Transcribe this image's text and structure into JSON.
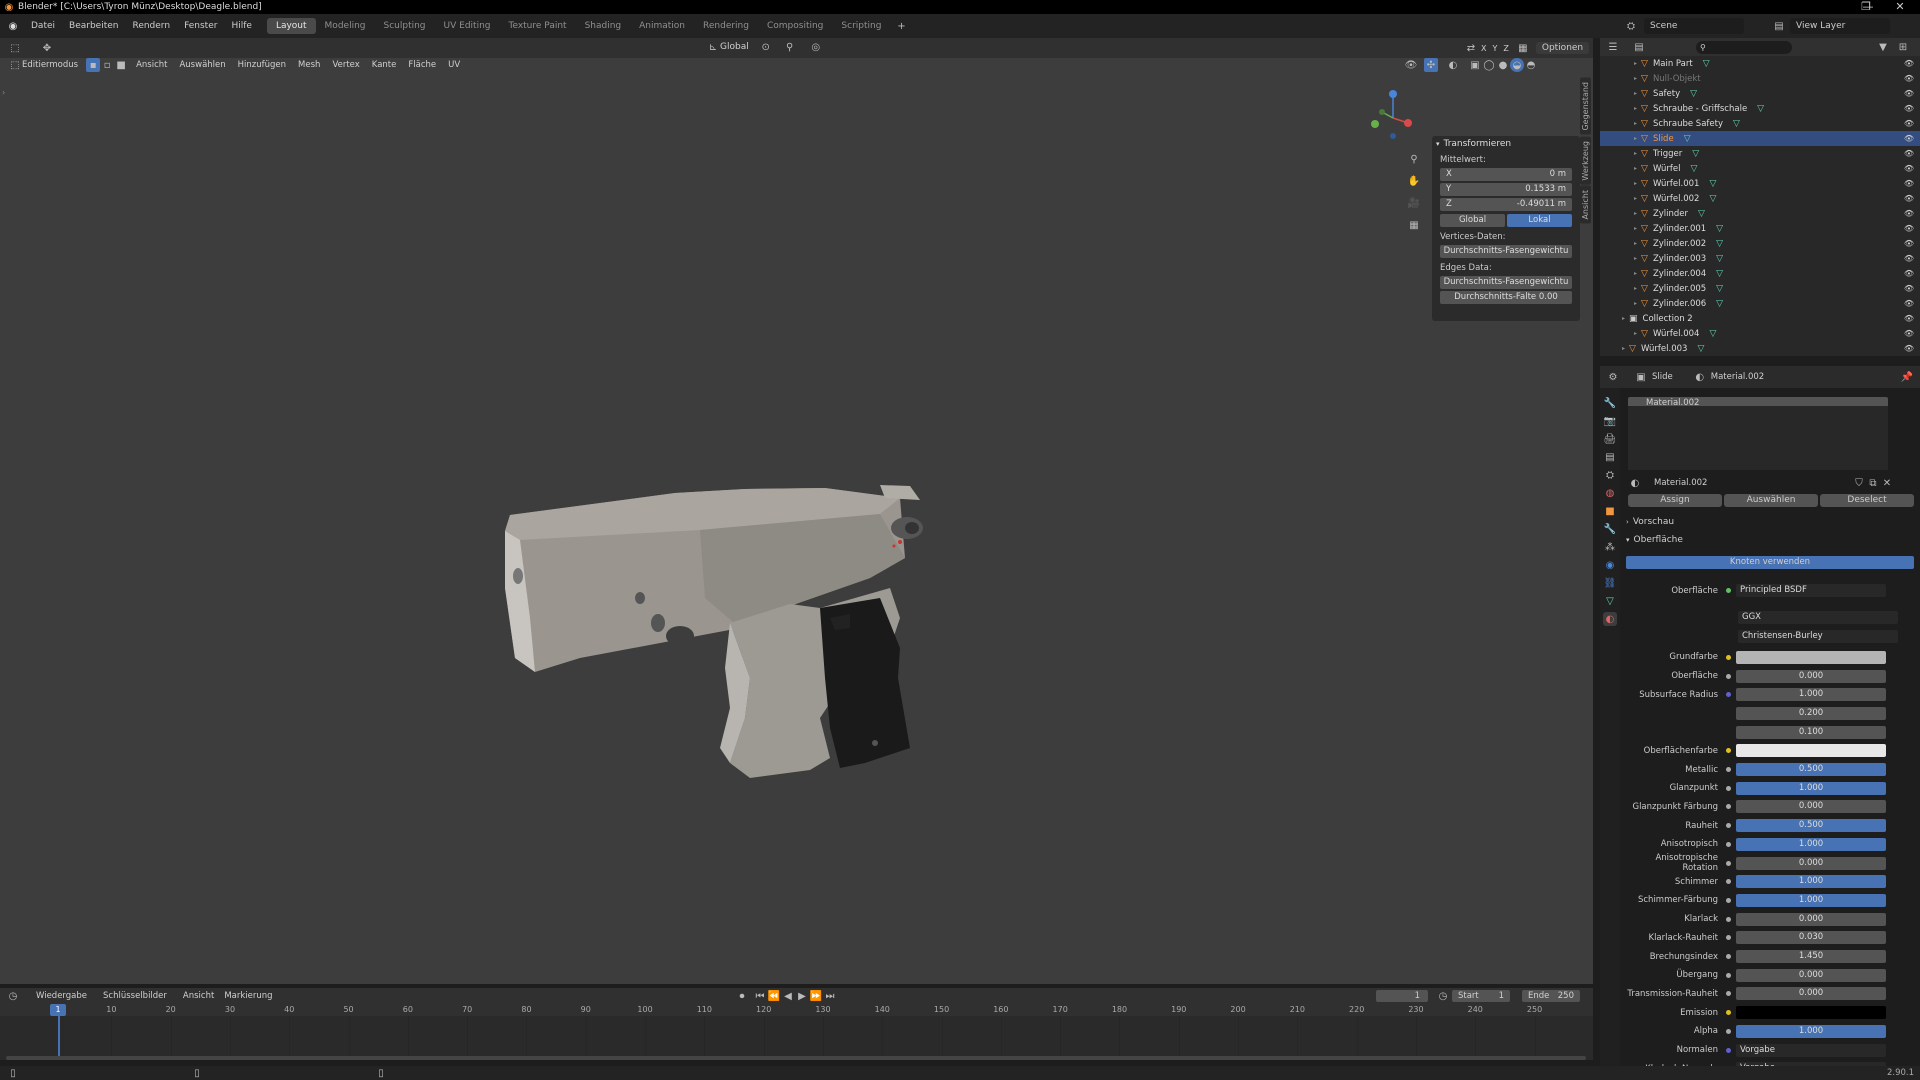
{
  "title": "Blender* [C:\\Users\\Tyron Münz\\Desktop\\Deagle.blend]",
  "menu": [
    "Datei",
    "Bearbeiten",
    "Rendern",
    "Fenster",
    "Hilfe"
  ],
  "workspaces": [
    "Layout",
    "Modeling",
    "Sculpting",
    "UV Editing",
    "Texture Paint",
    "Shading",
    "Animation",
    "Rendering",
    "Compositing",
    "Scripting"
  ],
  "scene": "Scene",
  "view_layer": "View Layer",
  "header3d": {
    "orientation": "Global",
    "options": "Optionen",
    "axes": [
      "X",
      "Y",
      "Z"
    ]
  },
  "header3d2": {
    "mode": "Editiermodus",
    "items": [
      "Ansicht",
      "Auswählen",
      "Hinzufügen",
      "Mesh",
      "Vertex",
      "Kante",
      "Fläche",
      "UV"
    ]
  },
  "npanel": {
    "title": "Transformieren",
    "median": "Mittelwert:",
    "x_label": "X",
    "x": "0 m",
    "y_label": "Y",
    "y": "0.1533 m",
    "z_label": "Z",
    "z": "-0.49011 m",
    "global": "Global",
    "lokal": "Lokal",
    "vertices": "Vertices-Daten:",
    "vbtn": "Durchschnitts-Fasengewichtu",
    "edges": "Edges Data:",
    "ebtn1": "Durchschnitts-Fasengewichtu",
    "ebtn2": "Durchschnitts-Falte 0.00"
  },
  "sidetabs": [
    "Gegenstand",
    "Werkzeug",
    "Ansicht"
  ],
  "outliner": [
    {
      "name": "Main Part",
      "sel": false,
      "dim": false
    },
    {
      "name": "Null-Objekt",
      "sel": false,
      "dim": true
    },
    {
      "name": "Safety",
      "sel": false,
      "dim": false
    },
    {
      "name": "Schraube - Griffschale",
      "sel": false,
      "dim": false
    },
    {
      "name": "Schraube Safety",
      "sel": false,
      "dim": false
    },
    {
      "name": "Slide",
      "sel": true,
      "dim": false
    },
    {
      "name": "Trigger",
      "sel": false,
      "dim": false
    },
    {
      "name": "Würfel",
      "sel": false,
      "dim": false
    },
    {
      "name": "Würfel.001",
      "sel": false,
      "dim": false
    },
    {
      "name": "Würfel.002",
      "sel": false,
      "dim": false
    },
    {
      "name": "Zylinder",
      "sel": false,
      "dim": false
    },
    {
      "name": "Zylinder.001",
      "sel": false,
      "dim": false
    },
    {
      "name": "Zylinder.002",
      "sel": false,
      "dim": false
    },
    {
      "name": "Zylinder.003",
      "sel": false,
      "dim": false
    },
    {
      "name": "Zylinder.004",
      "sel": false,
      "dim": false
    },
    {
      "name": "Zylinder.005",
      "sel": false,
      "dim": false
    },
    {
      "name": "Zylinder.006",
      "sel": false,
      "dim": false
    },
    {
      "name": "Collection 2",
      "sel": false,
      "dim": false
    },
    {
      "name": "Würfel.004",
      "sel": false,
      "dim": false
    },
    {
      "name": "Würfel.003",
      "sel": false,
      "dim": false
    }
  ],
  "props": {
    "object": "Slide",
    "material": "Material.002",
    "slot": "Material.002",
    "matfield": "Material.002",
    "assign": "Assign",
    "select": "Auswählen",
    "deselect": "Deselect",
    "preview": "Vorschau",
    "surface": "Oberfläche",
    "use_nodes": "Knoten verwenden",
    "surf_label": "Oberfläche",
    "surf_val": "Principled BSDF",
    "dist": "GGX",
    "sss": "Christensen-Burley"
  },
  "params": [
    {
      "label": "Grundfarbe",
      "value": "",
      "kind": "color",
      "color": "#b4b4b4",
      "dot": "#e0c020"
    },
    {
      "label": "Oberfläche",
      "value": "0.000",
      "kind": "num",
      "dot": "#aaa"
    },
    {
      "label": "Subsurface Radius",
      "value": "1.000",
      "kind": "num",
      "dot": "#6060d0"
    },
    {
      "label": "",
      "value": "0.200",
      "kind": "num",
      "dot": ""
    },
    {
      "label": "",
      "value": "0.100",
      "kind": "num",
      "dot": ""
    },
    {
      "label": "Oberflächenfarbe",
      "value": "",
      "kind": "color",
      "color": "#e8e8e8",
      "dot": "#e0c020"
    },
    {
      "label": "Metallic",
      "value": "0.500",
      "kind": "blue",
      "dot": "#aaa"
    },
    {
      "label": "Glanzpunkt",
      "value": "1.000",
      "kind": "blue",
      "dot": "#aaa"
    },
    {
      "label": "Glanzpunkt Färbung",
      "value": "0.000",
      "kind": "num",
      "dot": "#aaa"
    },
    {
      "label": "Rauheit",
      "value": "0.500",
      "kind": "blue",
      "dot": "#aaa"
    },
    {
      "label": "Anisotropisch",
      "value": "1.000",
      "kind": "blue",
      "dot": "#aaa"
    },
    {
      "label": "Anisotropische Rotation",
      "value": "0.000",
      "kind": "num",
      "dot": "#aaa"
    },
    {
      "label": "Schimmer",
      "value": "1.000",
      "kind": "blue",
      "dot": "#aaa"
    },
    {
      "label": "Schimmer-Färbung",
      "value": "1.000",
      "kind": "blue",
      "dot": "#aaa"
    },
    {
      "label": "Klarlack",
      "value": "0.000",
      "kind": "num",
      "dot": "#aaa"
    },
    {
      "label": "Klarlack-Rauheit",
      "value": "0.030",
      "kind": "num",
      "dot": "#aaa"
    },
    {
      "label": "Brechungsindex",
      "value": "1.450",
      "kind": "num",
      "dot": "#aaa"
    },
    {
      "label": "Übergang",
      "value": "0.000",
      "kind": "num",
      "dot": "#aaa"
    },
    {
      "label": "Transmission-Rauheit",
      "value": "0.000",
      "kind": "num",
      "dot": "#aaa"
    },
    {
      "label": "Emission",
      "value": "",
      "kind": "color",
      "color": "#000000",
      "dot": "#e0c020"
    },
    {
      "label": "Alpha",
      "value": "1.000",
      "kind": "blue",
      "dot": "#aaa"
    },
    {
      "label": "Normalen",
      "value": "Vorgabe",
      "kind": "text",
      "dot": "#6060d0"
    },
    {
      "label": "Klarlack-Normale",
      "value": "Vorgabe",
      "kind": "text",
      "dot": "#6060d0"
    }
  ],
  "timeline": {
    "playback": "Wiedergabe",
    "keys": "Schlüsselbilder",
    "view": "Ansicht",
    "markers": "Markierung",
    "current": "1",
    "start_label": "Start",
    "start": "1",
    "end_label": "Ende",
    "end": "250",
    "ticks": [
      "1",
      "10",
      "20",
      "30",
      "40",
      "50",
      "60",
      "70",
      "80",
      "90",
      "100",
      "110",
      "120",
      "130",
      "140",
      "150",
      "160",
      "170",
      "180",
      "190",
      "200",
      "210",
      "220",
      "230",
      "240",
      "250"
    ]
  },
  "version": "2.90.1",
  "icons": {
    "blender": "blender-logo-icon",
    "eye": "eye-icon",
    "mesh": "mesh-icon"
  }
}
